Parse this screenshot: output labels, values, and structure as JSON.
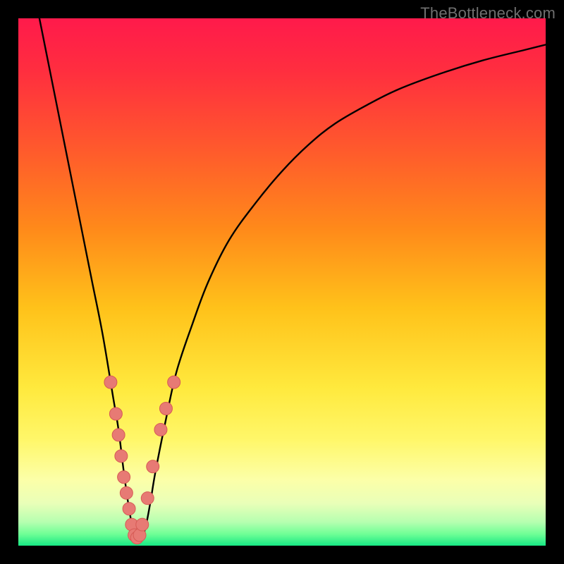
{
  "watermark": "TheBottleneck.com",
  "colors": {
    "frame": "#000000",
    "watermark": "#6f6f6f",
    "curve": "#000000",
    "marker_fill": "#e77a74",
    "marker_stroke": "#d65a55",
    "gradient_stops": [
      {
        "offset": 0.0,
        "color": "#ff1a4b"
      },
      {
        "offset": 0.1,
        "color": "#ff2e3f"
      },
      {
        "offset": 0.25,
        "color": "#ff5a2c"
      },
      {
        "offset": 0.4,
        "color": "#ff8a1a"
      },
      {
        "offset": 0.55,
        "color": "#ffc21a"
      },
      {
        "offset": 0.7,
        "color": "#ffe93d"
      },
      {
        "offset": 0.8,
        "color": "#fff76a"
      },
      {
        "offset": 0.875,
        "color": "#fcffa8"
      },
      {
        "offset": 0.92,
        "color": "#e9ffb8"
      },
      {
        "offset": 0.955,
        "color": "#b6ffb0"
      },
      {
        "offset": 0.978,
        "color": "#6fff96"
      },
      {
        "offset": 1.0,
        "color": "#17e884"
      }
    ]
  },
  "chart_data": {
    "type": "line",
    "title": "",
    "xlabel": "",
    "ylabel": "",
    "xlim": [
      0,
      100
    ],
    "ylim": [
      0,
      100
    ],
    "grid": false,
    "legend": false,
    "note": "x/y in percent of plot area; y=100 is top, y=0 is bottom. Curve is a V-shaped dip to ~0 near x≈22 then rises toward upper right.",
    "series": [
      {
        "name": "bottleneck-curve",
        "x": [
          4,
          6,
          8,
          10,
          12,
          14,
          16,
          18,
          19,
          20,
          21,
          22,
          23,
          24,
          25,
          26,
          28,
          30,
          33,
          36,
          40,
          45,
          50,
          55,
          60,
          66,
          72,
          80,
          88,
          96,
          100
        ],
        "y": [
          100,
          90,
          80,
          70,
          60,
          50,
          40,
          28,
          22,
          14,
          7,
          2,
          1,
          3,
          8,
          14,
          24,
          33,
          42,
          50,
          58,
          65,
          71,
          76,
          80,
          83.5,
          86.5,
          89.5,
          92,
          94,
          95
        ]
      }
    ],
    "markers": {
      "name": "highlighted-points",
      "note": "pink dots clustered near the valley on both branches",
      "points": [
        {
          "x": 17.5,
          "y": 31
        },
        {
          "x": 18.5,
          "y": 25
        },
        {
          "x": 19.0,
          "y": 21
        },
        {
          "x": 19.5,
          "y": 17
        },
        {
          "x": 20.0,
          "y": 13
        },
        {
          "x": 20.5,
          "y": 10
        },
        {
          "x": 21.0,
          "y": 7
        },
        {
          "x": 21.5,
          "y": 4
        },
        {
          "x": 22.0,
          "y": 2
        },
        {
          "x": 22.5,
          "y": 1.5
        },
        {
          "x": 23.0,
          "y": 2
        },
        {
          "x": 23.5,
          "y": 4
        },
        {
          "x": 24.5,
          "y": 9
        },
        {
          "x": 25.5,
          "y": 15
        },
        {
          "x": 27.0,
          "y": 22
        },
        {
          "x": 28.0,
          "y": 26
        },
        {
          "x": 29.5,
          "y": 31
        }
      ]
    }
  }
}
